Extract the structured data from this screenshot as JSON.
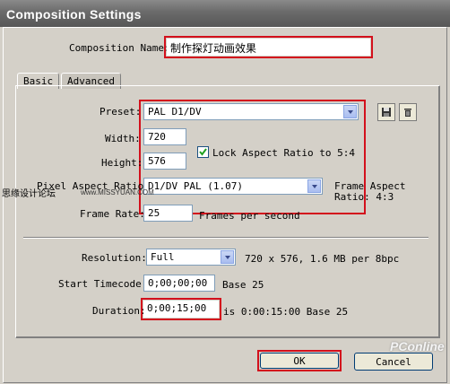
{
  "window": {
    "title": "Composition Settings"
  },
  "composition_name": {
    "label": "Composition Name:",
    "value": "制作探灯动画效果"
  },
  "tabs": [
    {
      "label": "Basic",
      "active": true
    },
    {
      "label": "Advanced",
      "active": false
    }
  ],
  "preset": {
    "label": "Preset:",
    "value": "PAL D1/DV",
    "save_icon": "floppy-icon",
    "delete_icon": "trash-icon"
  },
  "width": {
    "label": "Width:",
    "value": "720"
  },
  "height": {
    "label": "Height:",
    "value": "576"
  },
  "lock_aspect": {
    "label": "Lock Aspect Ratio to 5:4",
    "checked": true
  },
  "pixel_aspect": {
    "label": "Pixel Aspect Ratio:",
    "value": "D1/DV PAL (1.07)"
  },
  "frame_aspect": {
    "line1": "Frame Aspect",
    "line2": "Ratio: 4:3"
  },
  "frame_rate": {
    "label": "Frame Rate:",
    "value": "25",
    "unit": "Frames per second"
  },
  "resolution": {
    "label": "Resolution:",
    "value": "Full",
    "info": "720 x 576, 1.6 MB per 8bpc"
  },
  "start_timecode": {
    "label": "Start Timecode:",
    "value": "0;00;00;00",
    "base": "Base 25"
  },
  "duration": {
    "label": "Duration:",
    "value": "0;00;15;00",
    "info": "is 0:00:15:00  Base 25"
  },
  "buttons": {
    "ok": "OK",
    "cancel": "Cancel"
  },
  "watermarks": {
    "left": "思缘设计论坛",
    "site": "www.MISSYUAN.COM",
    "brand": "PConline"
  },
  "colors": {
    "highlight": "#d3101c",
    "titlebar": "#6a6a6a",
    "dialog": "#d4d0c8"
  }
}
